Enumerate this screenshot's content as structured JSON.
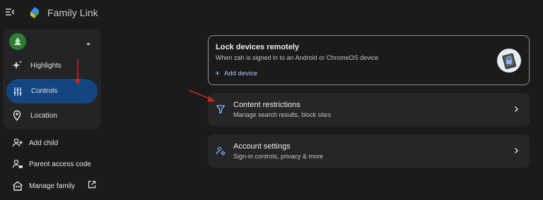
{
  "app": {
    "title": "Family Link"
  },
  "sidebar": {
    "nav": [
      {
        "label": "Highlights",
        "icon": "sparkle-icon"
      },
      {
        "label": "Controls",
        "icon": "tune-icon",
        "selected": true
      },
      {
        "label": "Location",
        "icon": "location-pin-icon"
      }
    ],
    "links": [
      {
        "label": "Add child",
        "icon": "person-add-icon"
      },
      {
        "label": "Parent access code",
        "icon": "person-key-icon"
      },
      {
        "label": "Manage family",
        "icon": "home-people-icon",
        "external": true
      }
    ]
  },
  "main": {
    "lock_card": {
      "title": "Lock devices remotely",
      "subtitle": "When zah is signed in to an Android or ChromeOS device",
      "action": "Add device"
    },
    "cards": [
      {
        "title": "Content restrictions",
        "subtitle": "Manage search results, block sites",
        "icon": "filter-icon"
      },
      {
        "title": "Account settings",
        "subtitle": "Sign-in controls, privacy & more",
        "icon": "account-settings-icon"
      }
    ]
  },
  "colors": {
    "background": "#1b1b1c",
    "selected_nav": "#134583",
    "accent": "#a8c7fa",
    "annotation_arrow": "#c0281e"
  }
}
